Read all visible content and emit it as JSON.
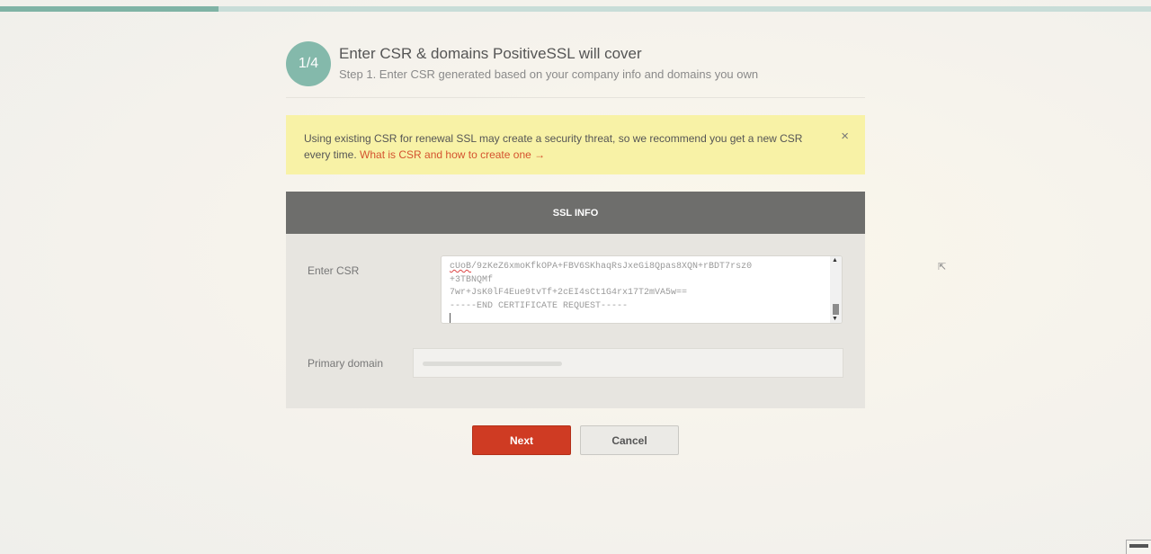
{
  "progress": {
    "fraction": 0.19
  },
  "step": {
    "badge": "1/4",
    "title": "Enter CSR & domains PositiveSSL will cover",
    "subtitle": "Step 1. Enter CSR generated based on your company info and domains you own"
  },
  "alert": {
    "text": "Using existing CSR for renewal SSL may create a security threat, so we recommend you get a new CSR every time.",
    "link": "What is CSR and how to create one →",
    "close": "×"
  },
  "panel": {
    "header": "SSL INFO",
    "csr_label": "Enter CSR",
    "csr_value_first": "cUoB",
    "csr_value_rest": "/9zKeZ6xmoKfkOPA+FBV6SKhaqRsJxeGi8Qpas8XQN+rBDT7rsz0\n+3TBNQMf\n7wr+JsK0lF4Eue9tvTf+2cEI4sCt1G4rx17T2mVA5w==\n-----END CERTIFICATE REQUEST-----",
    "primary_label": "Primary domain",
    "primary_value": ""
  },
  "buttons": {
    "next": "Next",
    "cancel": "Cancel"
  },
  "colors": {
    "accent": "#84b9ab",
    "next_button": "#cf3b23",
    "alert_bg": "#f8f2a6",
    "link": "#d4532f"
  }
}
